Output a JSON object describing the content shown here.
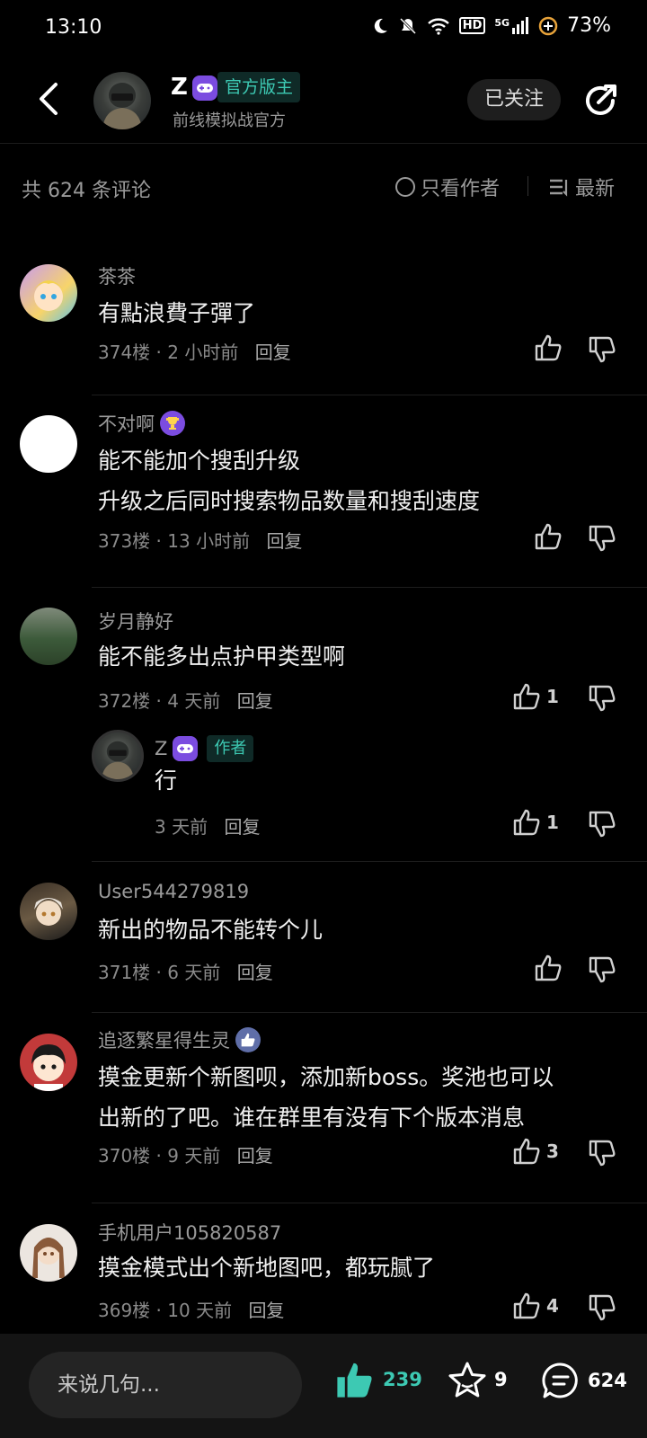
{
  "status_bar": {
    "time": "13:10",
    "battery": "73%",
    "net_type": "5G",
    "hd": "HD"
  },
  "header": {
    "name": "Z",
    "badge": "官方版主",
    "subtitle": "前线模拟战官方",
    "follow_label": "已关注"
  },
  "filter": {
    "total": "共 624 条评论",
    "only_author": "只看作者",
    "sort": "最新"
  },
  "comments": [
    {
      "user": "茶茶",
      "lines": [
        "有點浪費子彈了"
      ],
      "floor": "374楼",
      "time": "2 小时前",
      "reply": "回复",
      "likes": ""
    },
    {
      "user": "不对啊",
      "lines": [
        "能不能加个搜刮升级",
        "升级之后同时搜索物品数量和搜刮速度"
      ],
      "floor": "373楼",
      "time": "13 小时前",
      "reply": "回复",
      "likes": ""
    },
    {
      "user": "岁月静好",
      "lines": [
        "能不能多出点护甲类型啊"
      ],
      "floor": "372楼",
      "time": "4 天前",
      "reply": "回复",
      "likes": "1",
      "sub_reply": {
        "user": "Z",
        "tag": "作者",
        "text": "行",
        "time": "3 天前",
        "reply": "回复",
        "likes": "1"
      }
    },
    {
      "user": "User544279819",
      "lines": [
        "新出的物品不能转个儿"
      ],
      "floor": "371楼",
      "time": "6 天前",
      "reply": "回复",
      "likes": ""
    },
    {
      "user": "追逐繁星得生灵",
      "lines": [
        "摸金更新个新图呗，添加新boss。奖池也可以",
        "出新的了吧。谁在群里有没有下个版本消息"
      ],
      "floor": "370楼",
      "time": "9 天前",
      "reply": "回复",
      "likes": "3"
    },
    {
      "user": "手机用户105820587",
      "lines": [
        "摸金模式出个新地图吧，都玩腻了"
      ],
      "floor": "369楼",
      "time": "10 天前",
      "reply": "回复",
      "likes": "4"
    }
  ],
  "bottom_bar": {
    "input_placeholder": "来说几句...",
    "likes": "239",
    "favorites": "9",
    "comments": "624"
  },
  "colors": {
    "accent_teal": "#3dc9b3",
    "game_purple": "#7b4ce0",
    "background": "#000000"
  }
}
